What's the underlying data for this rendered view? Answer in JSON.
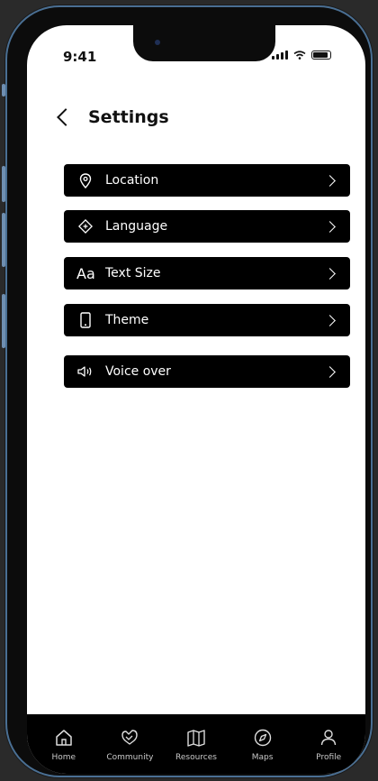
{
  "status_bar": {
    "time": "9:41"
  },
  "header": {
    "title": "Settings"
  },
  "settings": [
    {
      "label": "Location",
      "icon": "location-pin-icon"
    },
    {
      "label": "Language",
      "icon": "language-icon"
    },
    {
      "label": "Text Size",
      "icon": "text-size-icon",
      "icon_text": "Aa"
    },
    {
      "label": "Theme",
      "icon": "phone-theme-icon"
    },
    {
      "label": "Voice over",
      "icon": "speaker-icon"
    }
  ],
  "bottom_nav": [
    {
      "label": "Home",
      "icon": "home-icon"
    },
    {
      "label": "Community",
      "icon": "community-icon"
    },
    {
      "label": "Resources",
      "icon": "map-book-icon"
    },
    {
      "label": "Maps",
      "icon": "compass-icon"
    },
    {
      "label": "Profile",
      "icon": "profile-icon"
    }
  ],
  "colors": {
    "row_background": "#000000",
    "screen_background": "#ffffff",
    "frame_accent": "#4a6f93"
  }
}
